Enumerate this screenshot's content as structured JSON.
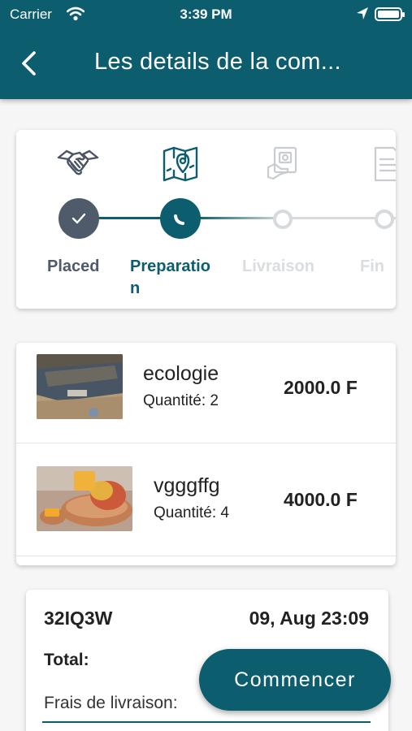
{
  "status_bar": {
    "carrier": "Carrier",
    "time": "3:39 PM"
  },
  "header": {
    "title": "Les details de la com..."
  },
  "stepper": {
    "active_index": 1,
    "steps": [
      {
        "label": "Placed",
        "icon": "handshake-icon",
        "state": "done"
      },
      {
        "label": "Preparatio\nn",
        "icon": "map-icon",
        "state": "active"
      },
      {
        "label": "Livraison",
        "icon": "delivery-icon",
        "state": "pending"
      },
      {
        "label": "Fin",
        "icon": "document-icon",
        "state": "pending"
      }
    ]
  },
  "items": [
    {
      "name": "ecologie",
      "quantity": "Quantité: 2",
      "price": "2000.0 F"
    },
    {
      "name": "vgggffg",
      "quantity": "Quantité: 4",
      "price": "4000.0 F"
    }
  ],
  "order": {
    "code": "32IQ3W",
    "date": "09, Aug 23:09",
    "total_label": "Total:",
    "fees_label": "Frais de livraison:"
  },
  "fab": {
    "label": "Commencer"
  },
  "colors": {
    "primary": "#0c5d6e",
    "done": "#4f5a6a",
    "inactive": "#d7dadd"
  }
}
